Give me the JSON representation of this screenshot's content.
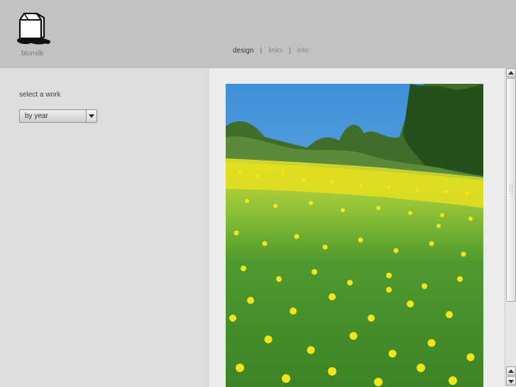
{
  "header": {
    "brand": "blumilk",
    "logo_icon": "milk-carton-icon",
    "nav": [
      {
        "label": "design",
        "active": true
      },
      {
        "label": "links",
        "active": false
      },
      {
        "label": "info",
        "active": false
      }
    ],
    "separator": "|"
  },
  "sidebar": {
    "select_label": "select a work",
    "dropdown": {
      "selected": "by year",
      "arrow_icon": "chevron-down-icon"
    }
  },
  "main": {
    "image_subject": "meadow-photo"
  },
  "colors": {
    "header_bg": "#c2c2c2",
    "sidebar_bg": "#dddddd",
    "content_bg": "#ececec",
    "nav_active": "#3a3a3a",
    "nav_inactive": "#8a8a8a"
  }
}
